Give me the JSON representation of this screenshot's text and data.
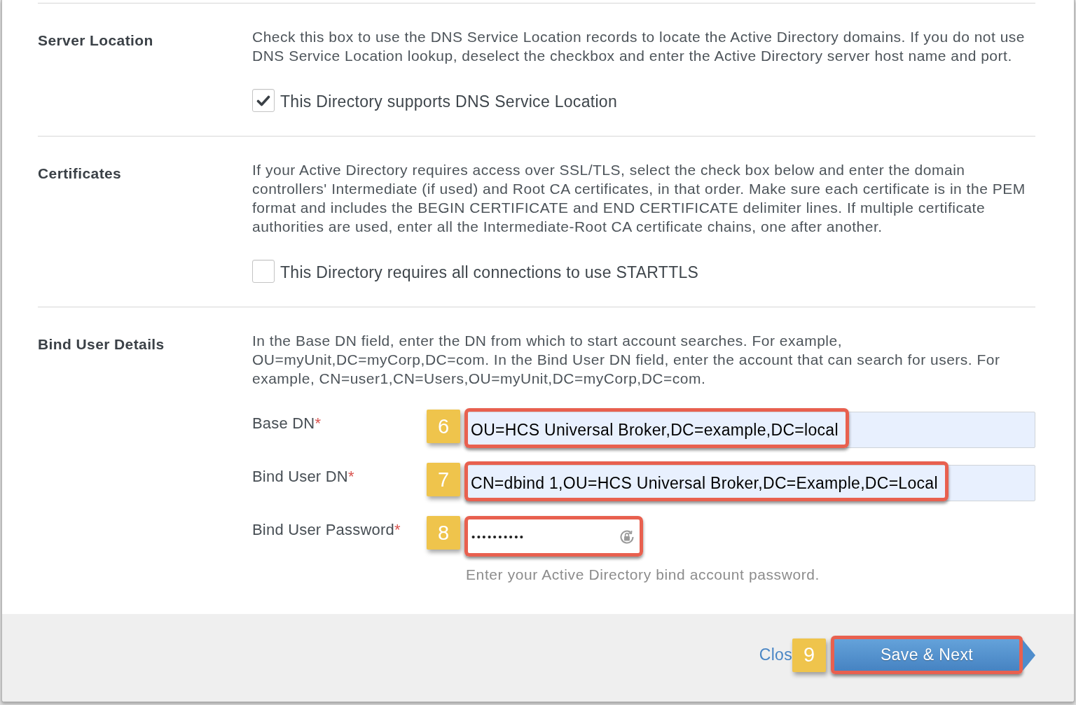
{
  "sections": [
    {
      "title": "Server Location",
      "description": "Check this box to use the DNS Service Location records to locate the Active Directory domains. If you do not use DNS Service Location lookup, deselect the checkbox and enter the Active Directory server host name and port.",
      "checkbox": {
        "label": "This Directory supports DNS Service Location",
        "checked": true
      }
    },
    {
      "title": "Certificates",
      "description": "If your Active Directory requires access over SSL/TLS, select the check box below and enter the domain controllers' Intermediate (if used) and Root CA certificates, in that order. Make sure each certificate is in the PEM format and includes the BEGIN CERTIFICATE and END CERTIFICATE delimiter lines. If multiple certificate authorities are used, enter all the Intermediate-Root CA certificate chains, one after another.",
      "checkbox": {
        "label": "This Directory requires all connections to use STARTTLS",
        "checked": false
      }
    },
    {
      "title": "Bind User Details",
      "description": "In the Base DN field, enter the DN from which to start account searches. For example, OU=myUnit,DC=myCorp,DC=com. In the Bind User DN field, enter the account that can search for users. For example, CN=user1,CN=Users,OU=myUnit,DC=myCorp,DC=com.",
      "fields": [
        {
          "kind": "text",
          "label": "Base DN",
          "required_mark": "*",
          "step": "6",
          "value": "OU=HCS Universal Broker,DC=example,DC=local",
          "autofilled": true,
          "focused": false,
          "highlighted": true
        },
        {
          "kind": "text",
          "label": "Bind User DN",
          "required_mark": "*",
          "step": "7",
          "value": "CN=dbind 1,OU=HCS Universal Broker,DC=Example,DC=Local",
          "autofilled": true,
          "focused": false,
          "highlighted": true
        },
        {
          "kind": "password",
          "label": "Bind User Password",
          "required_mark": "*",
          "step": "8",
          "value": "••••••••••",
          "autofilled": false,
          "focused": true,
          "highlighted": true,
          "hint": "Enter your Active Directory bind account password."
        }
      ]
    }
  ],
  "footer": {
    "close_link": "Clos",
    "save_button": {
      "step": "9",
      "label": "Save & Next",
      "highlighted": true
    }
  }
}
